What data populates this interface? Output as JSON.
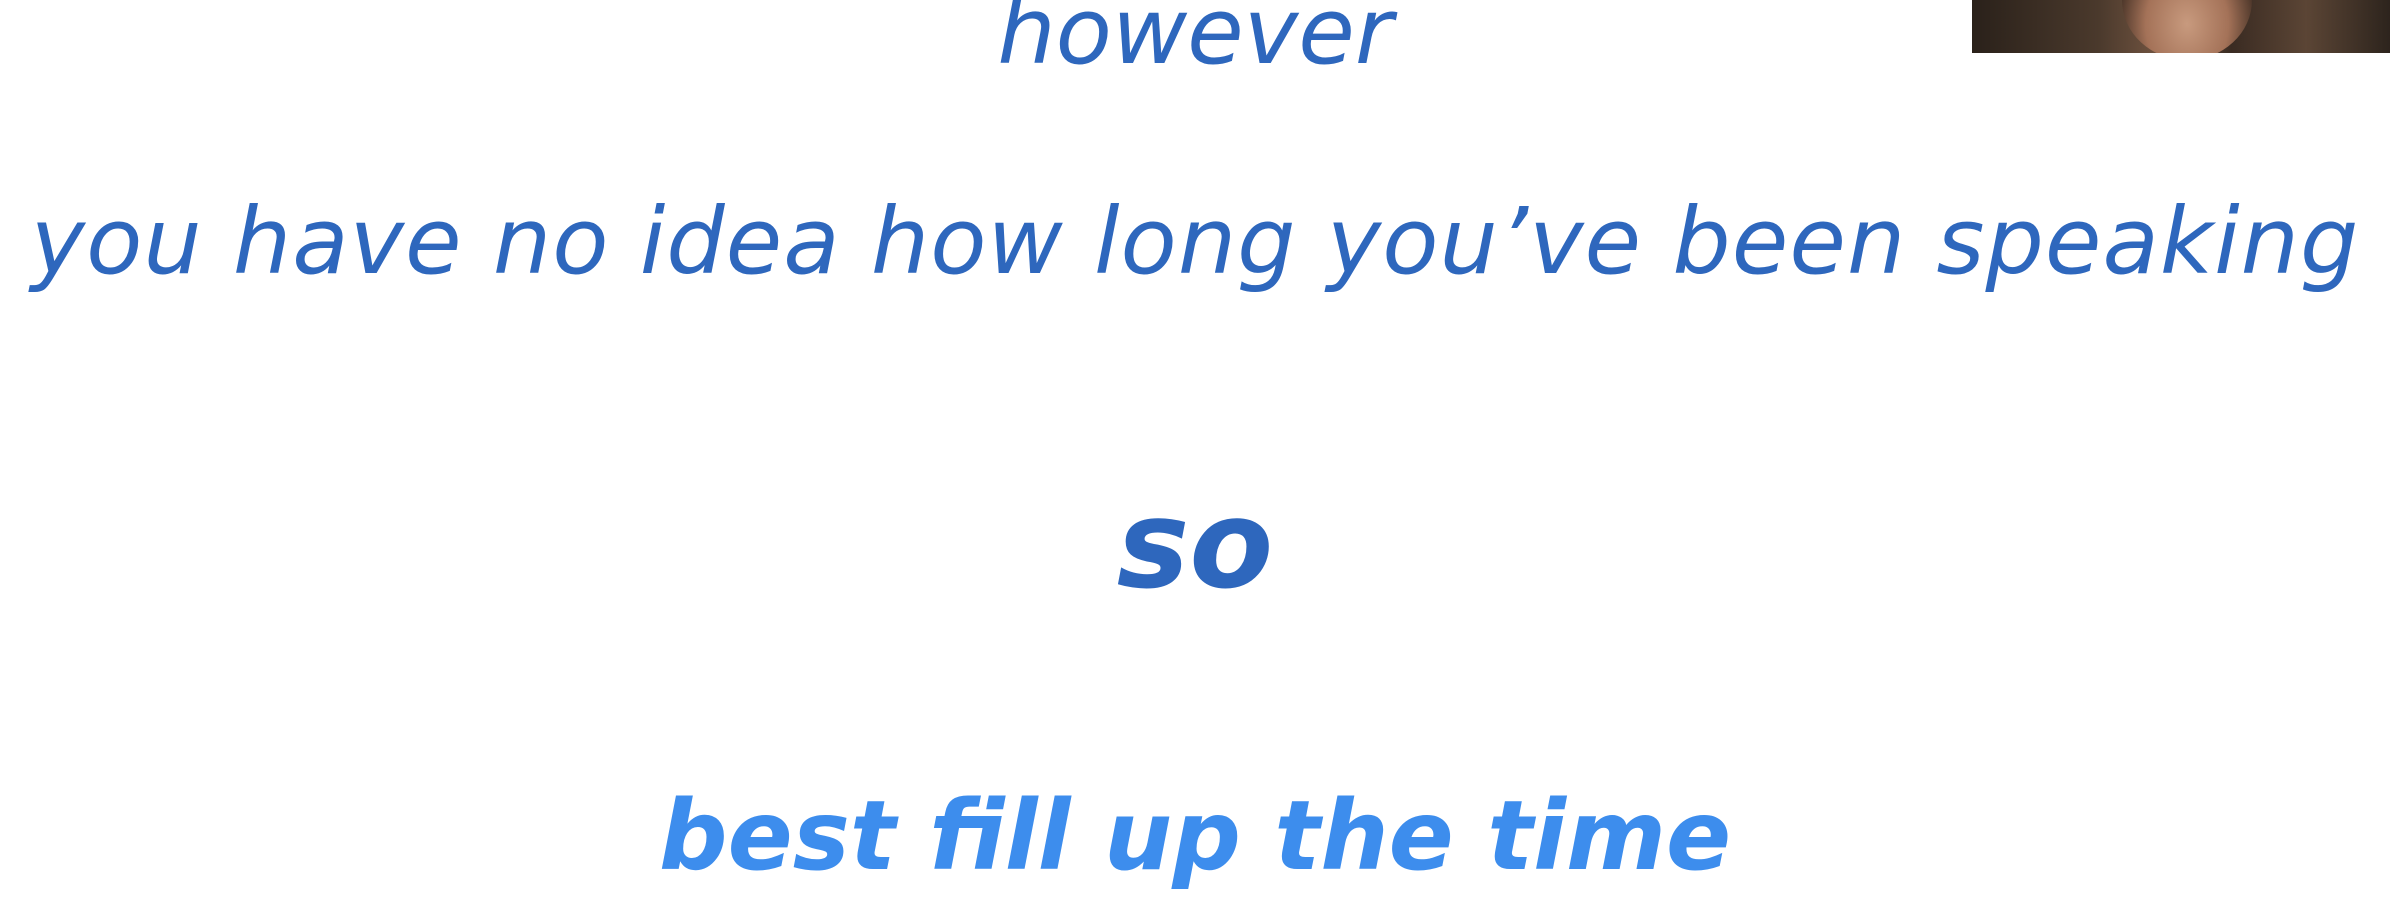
{
  "slide": {
    "lines": [
      "however",
      "you have no idea how long you’ve been speaking",
      "so",
      "best fill up the time"
    ]
  },
  "webcam": {
    "icon": "presenter-webcam-thumbnail"
  },
  "colors": {
    "background": "#ffffff",
    "primary_text": "#2e67bd",
    "accent_text": "#3d8ded"
  }
}
